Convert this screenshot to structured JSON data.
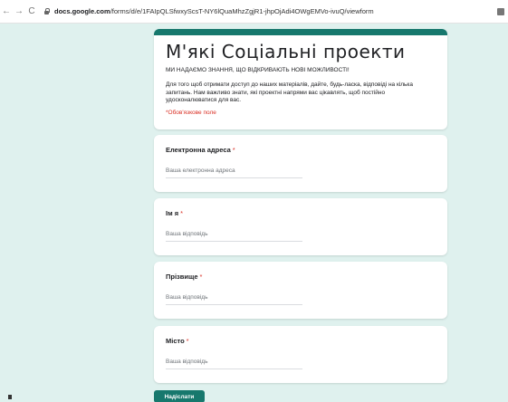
{
  "browser": {
    "nav_back": "←",
    "nav_forward": "→",
    "reload": "C",
    "url_domain": "docs.google.com",
    "url_path": "/forms/d/e/1FAIpQLSfwxyScsT-NY6lQuaMhzZgjR1-jhpOjAdi4OWgEMVo-ivuQ/viewform"
  },
  "form": {
    "title": "М'які Соціальні проекти",
    "subtitle": "МИ НАДАЄМО ЗНАННЯ, ЩО ВІДКРИВАЮТЬ НОВІ МОЖЛИВОСТІ!",
    "description": "Для того щоб отримати доступ до наших матеріалів, дайте, будь-ласка, відповіді на кілька запитань. Нам важливо знати, які проектні напрями вас цікавлять, щоб постійно удосконалюватися для вас.",
    "required_note": "*Обов'язкове поле",
    "accent_color": "#17786d",
    "questions": [
      {
        "label": "Електронна адреса",
        "required_mark": "*",
        "placeholder": "Ваша електронна адреса"
      },
      {
        "label": "Ім я",
        "required_mark": "*",
        "placeholder": "Ваша відповідь"
      },
      {
        "label": "Прізвище",
        "required_mark": "*",
        "placeholder": "Ваша відповідь"
      },
      {
        "label": "Місто",
        "required_mark": "*",
        "placeholder": "Ваша відповідь"
      }
    ],
    "submit_label": "Надіслати"
  }
}
